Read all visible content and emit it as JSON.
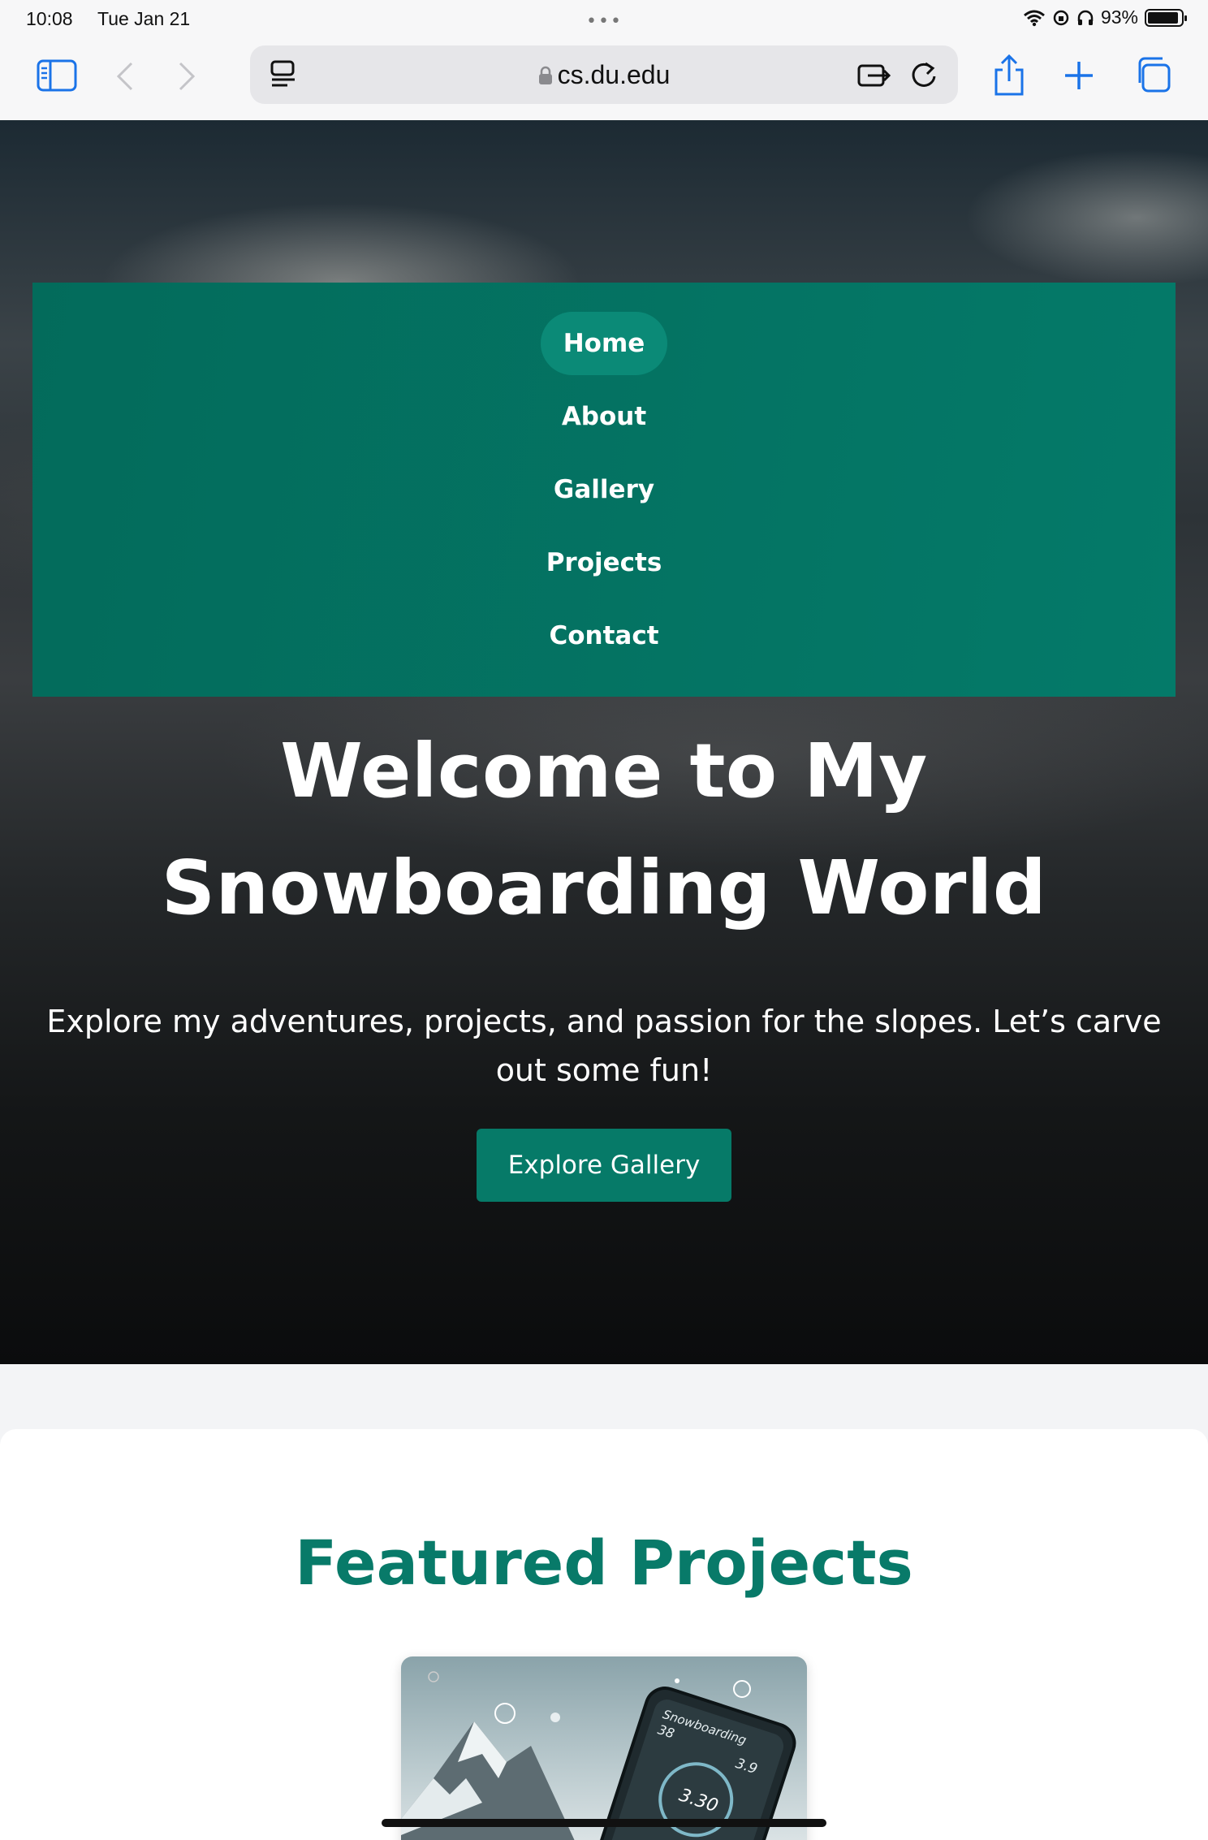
{
  "status": {
    "time": "10:08",
    "date": "Tue Jan 21",
    "battery": "93%",
    "battery_level": 0.93
  },
  "browser": {
    "url": "cs.du.edu"
  },
  "nav": {
    "items": [
      {
        "label": "Home",
        "active": true
      },
      {
        "label": "About"
      },
      {
        "label": "Gallery"
      },
      {
        "label": "Projects"
      },
      {
        "label": "Contact"
      }
    ]
  },
  "hero": {
    "title_line1": "Welcome to My",
    "title_line2": "Snowboarding World",
    "subtitle_line1": "Explore my adventures, projects, and passion for the slopes. Let’s carve",
    "subtitle_line2": "out some fun!",
    "button": "Explore Gallery"
  },
  "featured": {
    "title": "Featured Projects",
    "card_image": {
      "label": "Snowboarding",
      "num1": "38",
      "num2": "3.9",
      "num3": "3.30"
    }
  },
  "colors": {
    "accent": "#047a69",
    "nav_bg": "#036b5b",
    "pill": "#0b8a77"
  }
}
